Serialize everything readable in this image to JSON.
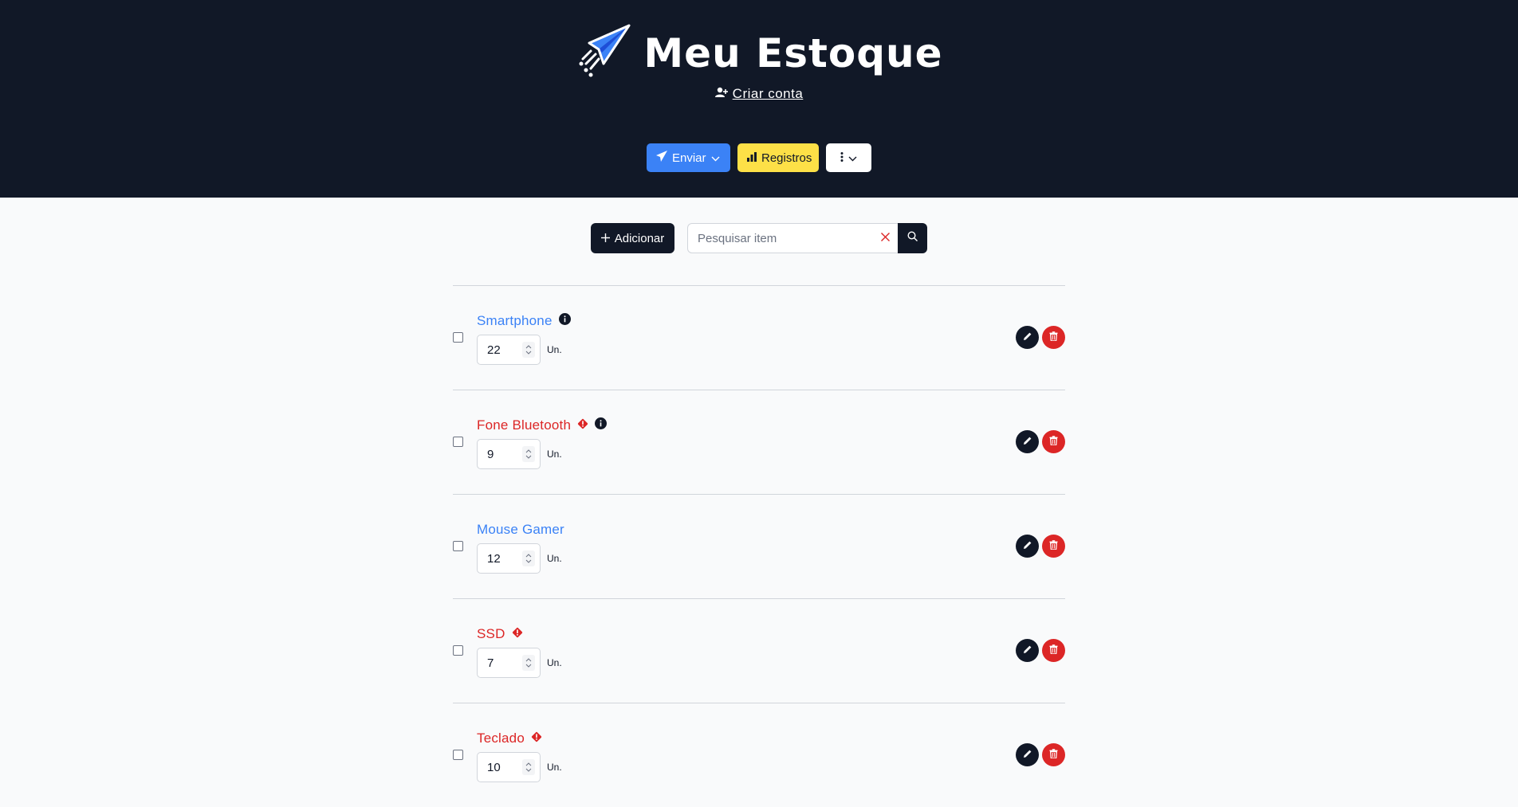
{
  "header": {
    "title": "Meu Estoque",
    "signup_label": " Criar conta",
    "brand_icon": "rocket-icon"
  },
  "toolbar": {
    "send_label": "Enviar",
    "logs_label": "Registros"
  },
  "search": {
    "add_label": "Adicionar",
    "placeholder": "Pesquisar item"
  },
  "items": [
    {
      "name": "Smartphone",
      "qty": "22",
      "unit": "Un.",
      "status": "ok",
      "warning": false,
      "info": true
    },
    {
      "name": "Fone Bluetooth",
      "qty": "9",
      "unit": "Un.",
      "status": "low",
      "warning": true,
      "info": true
    },
    {
      "name": "Mouse Gamer",
      "qty": "12",
      "unit": "Un.",
      "status": "ok",
      "warning": false,
      "info": false
    },
    {
      "name": "SSD",
      "qty": "7",
      "unit": "Un.",
      "status": "low",
      "warning": true,
      "info": false
    },
    {
      "name": "Teclado",
      "qty": "10",
      "unit": "Un.",
      "status": "low",
      "warning": true,
      "info": false
    }
  ],
  "colors": {
    "header_bg": "#111827",
    "accent_blue": "#3b82f6",
    "accent_yellow": "#fde047",
    "danger": "#dc2626"
  }
}
